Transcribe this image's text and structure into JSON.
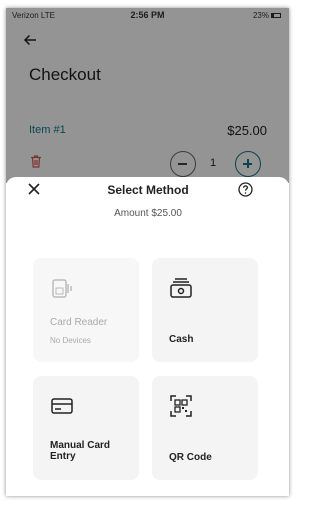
{
  "status_bar": {
    "carrier": "Verizon  LTE",
    "time": "2:56 PM",
    "battery": "23%"
  },
  "checkout": {
    "title": "Checkout",
    "item": {
      "label": "Item #1",
      "price": "$25.00",
      "quantity": "1"
    }
  },
  "sheet": {
    "title": "Select Method",
    "amount": "Amount $25.00",
    "methods": [
      {
        "title": "Card Reader",
        "subtitle": "No Devices",
        "icon": "card-reader-icon",
        "enabled": false
      },
      {
        "title": "Cash",
        "icon": "cash-icon",
        "enabled": true
      },
      {
        "title": "Manual Card\nEntry",
        "icon": "credit-card-icon",
        "enabled": true
      },
      {
        "title": "QR Code",
        "icon": "qr-code-icon",
        "enabled": true
      }
    ]
  },
  "colors": {
    "accent": "#0a7c82",
    "delete": "#d9534f",
    "card_bg": "#f4f4f4"
  }
}
